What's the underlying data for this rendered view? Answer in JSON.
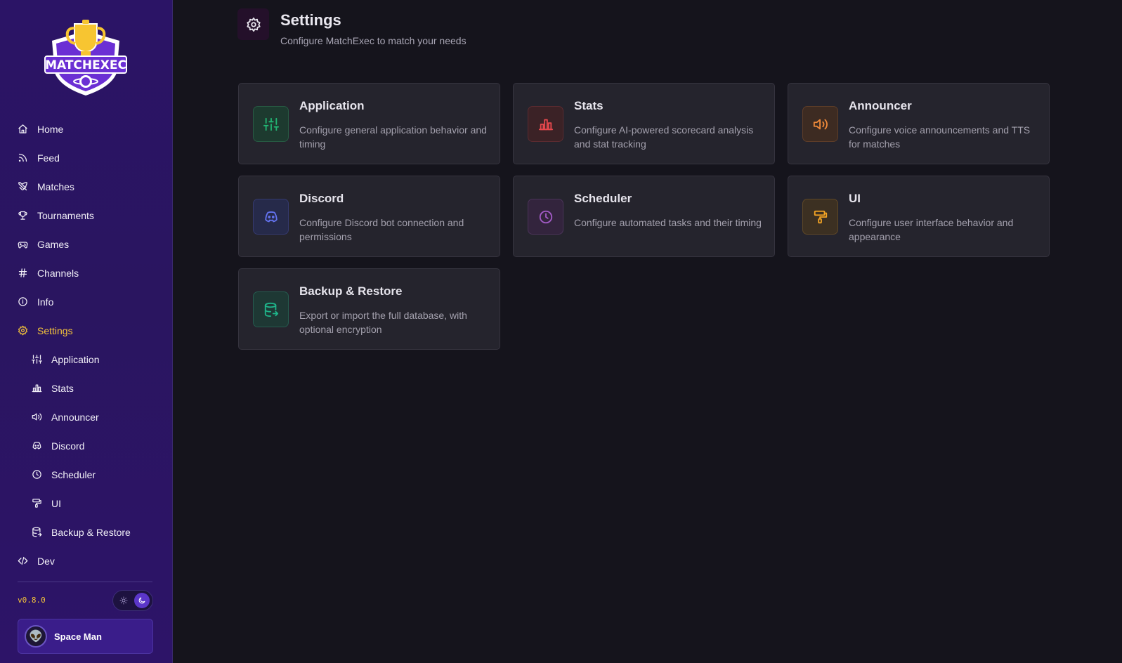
{
  "brand": {
    "name": "MATCHEXEC"
  },
  "nav": {
    "items": [
      {
        "label": "Home"
      },
      {
        "label": "Feed"
      },
      {
        "label": "Matches"
      },
      {
        "label": "Tournaments"
      },
      {
        "label": "Games"
      },
      {
        "label": "Channels"
      },
      {
        "label": "Info"
      },
      {
        "label": "Settings"
      },
      {
        "label": "Application"
      },
      {
        "label": "Stats"
      },
      {
        "label": "Announcer"
      },
      {
        "label": "Discord"
      },
      {
        "label": "Scheduler"
      },
      {
        "label": "UI"
      },
      {
        "label": "Backup & Restore"
      },
      {
        "label": "Dev"
      }
    ],
    "active": "Settings"
  },
  "footer": {
    "version": "v0.8.0",
    "theme": "dark",
    "user": {
      "name": "Space Man",
      "avatar": "alien-icon"
    }
  },
  "header": {
    "title": "Settings",
    "subtitle": "Configure MatchExec to match your needs"
  },
  "cards": [
    {
      "title": "Application",
      "desc": "Configure general application behavior and timing",
      "icon": "sliders-icon",
      "color": "#22b573"
    },
    {
      "title": "Stats",
      "desc": "Configure AI-powered scorecard analysis and stat tracking",
      "icon": "bar-chart-icon",
      "color": "#e5484d"
    },
    {
      "title": "Announcer",
      "desc": "Configure voice announcements and TTS for matches",
      "icon": "speaker-icon",
      "color": "#f08a3a"
    },
    {
      "title": "Discord",
      "desc": "Configure Discord bot connection and permissions",
      "icon": "discord-icon",
      "color": "#6473f0"
    },
    {
      "title": "Scheduler",
      "desc": "Configure automated tasks and their timing",
      "icon": "clock-icon",
      "color": "#a35bc7"
    },
    {
      "title": "UI",
      "desc": "Configure user interface behavior and appearance",
      "icon": "paint-roller-icon",
      "color": "#f5a524"
    },
    {
      "title": "Backup & Restore",
      "desc": "Export or import the full database, with optional encryption",
      "icon": "database-export-icon",
      "color": "#1fb58a"
    }
  ],
  "colors": {
    "accent": "#f5c43a",
    "sidebar": "#2b1466",
    "background": "#15141c"
  }
}
